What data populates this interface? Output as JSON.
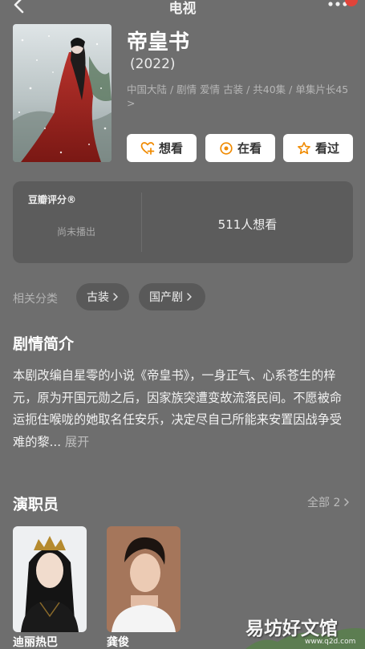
{
  "nav": {
    "title": "电视"
  },
  "show": {
    "title": "帝皇书",
    "year": "(2022)",
    "meta": "中国大陆 / 剧情 爱情 古装 / 共40集 / 单集片长45 >"
  },
  "actions": [
    {
      "label": "想看",
      "icon": "heart-plus-icon"
    },
    {
      "label": "在看",
      "icon": "target-icon"
    },
    {
      "label": "看过",
      "icon": "star-icon"
    }
  ],
  "rating": {
    "label": "豆瓣评分®",
    "status": "尚未播出",
    "want_count": "511人想看"
  },
  "related": {
    "label": "相关分类",
    "tags": [
      "古装",
      "国产剧"
    ]
  },
  "synopsis": {
    "title": "剧情简介",
    "text": "本剧改编自星零的小说《帝皇书》，一身正气、心系苍生的梓元，原为开国元勋之后，因家族突遭变故流落民间。不愿被命运扼住喉咙的她取名任安乐，决定尽自己所能来安置因战争受难的黎...",
    "expand": "展开"
  },
  "cast": {
    "title": "演职员",
    "all_label": "全部 2",
    "members": [
      {
        "name": "迪丽热巴"
      },
      {
        "name": "龚俊"
      }
    ]
  },
  "watermark": {
    "text": "易坊好文馆",
    "url": "www.q2d.com"
  },
  "colors": {
    "background": "#6e6e6e",
    "card": "#5c5c5c",
    "accent": "#f08a00"
  }
}
